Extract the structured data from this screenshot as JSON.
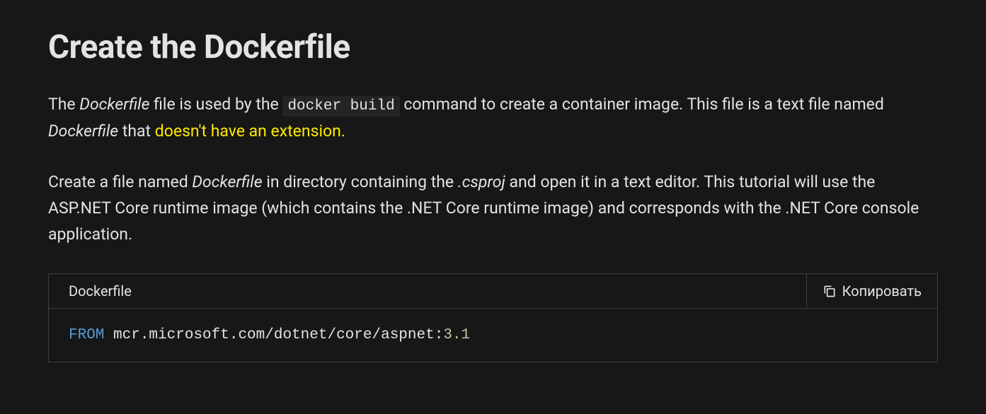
{
  "heading": "Create the Dockerfile",
  "para1": {
    "t1": "The ",
    "italic1": "Dockerfile",
    "t2": " file is used by the ",
    "code1": "docker build",
    "t3": " command to create a container image. This file is a text file named ",
    "italic2": "Dockerfile",
    "t4": " that ",
    "highlight": "doesn't have an extension.",
    "t5": ""
  },
  "para2": {
    "t1": "Create a file named ",
    "italic1": "Dockerfile",
    "t2": " in directory containing the ",
    "italic2": ".csproj",
    "t3": " and open it in a text editor. This tutorial will use the ASP.NET Core runtime image (which contains the .NET Core runtime image) and corresponds with the .NET Core console application."
  },
  "codeBlock": {
    "language": "Dockerfile",
    "copyLabel": "Копировать",
    "code": {
      "keyword": "FROM",
      "text": " mcr.microsoft.com/dotnet/core/aspnet:",
      "version": "3.1"
    }
  }
}
